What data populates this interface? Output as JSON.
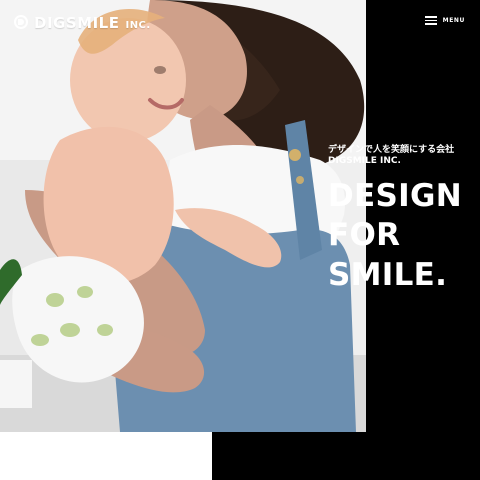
{
  "header": {
    "brand": "DIGSMILE",
    "brand_suffix": "INC.",
    "menu_label": "MENU"
  },
  "hero": {
    "tagline_jp": "デザインで人を笑顔にする会社",
    "tagline_en": "DIGSMILE INC.",
    "headline_lines": [
      "DESIGN",
      "FOR",
      "SMILE."
    ]
  },
  "colors": {
    "background": "#000000",
    "text": "#ffffff",
    "accent_bottom_left": "#ffffff"
  },
  "icons": {
    "logo_mark": "circle-d-logo-icon",
    "menu": "hamburger-menu-icon"
  }
}
